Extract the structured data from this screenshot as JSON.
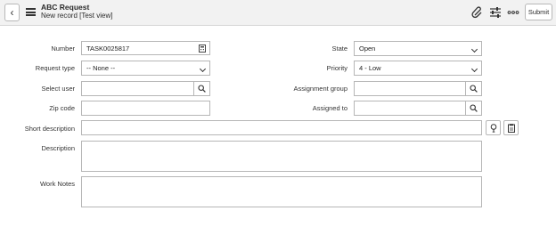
{
  "header": {
    "title": "ABC Request",
    "subtitle": "New record [Test view]",
    "submit_label": "Submit"
  },
  "form": {
    "number": {
      "label": "Number",
      "value": "TASK0025817"
    },
    "request_type": {
      "label": "Request type",
      "value": "-- None --"
    },
    "select_user": {
      "label": "Select user",
      "value": ""
    },
    "zip_code": {
      "label": "Zip code",
      "value": ""
    },
    "short_description": {
      "label": "Short description",
      "value": ""
    },
    "description": {
      "label": "Description",
      "value": ""
    },
    "work_notes": {
      "label": "Work Notes",
      "value": ""
    },
    "state": {
      "label": "State",
      "value": "Open"
    },
    "priority": {
      "label": "Priority",
      "value": "4 - Low"
    },
    "assignment_group": {
      "label": "Assignment group",
      "value": ""
    },
    "assigned_to": {
      "label": "Assigned to",
      "value": ""
    }
  },
  "icons": {
    "back": "chevron-left-icon",
    "menu": "hamburger-menu-icon",
    "attachment": "paperclip-icon",
    "personalize": "sliders-icon",
    "more": "more-options-icon",
    "calculator": "calculator-icon",
    "search": "search-icon",
    "suggestion": "lightbulb-icon",
    "template": "clipboard-icon"
  }
}
